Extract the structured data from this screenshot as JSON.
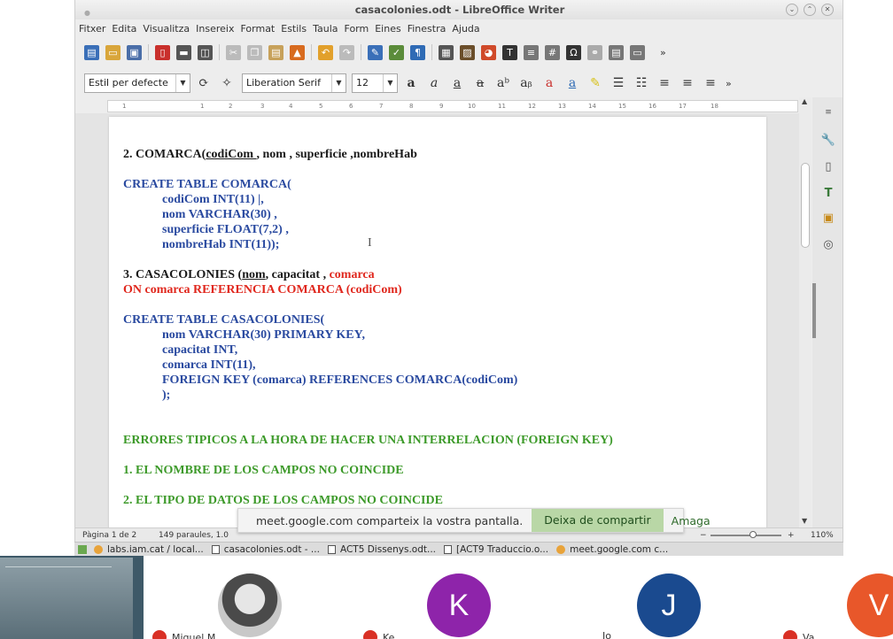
{
  "window": {
    "title": "casacolonies.odt - LibreOffice Writer"
  },
  "menu": [
    "Fitxer",
    "Edita",
    "Visualitza",
    "Insereix",
    "Format",
    "Estils",
    "Taula",
    "Form",
    "Eines",
    "Finestra",
    "Ajuda"
  ],
  "format_toolbar": {
    "paragraph_style": "Estil per defecte",
    "font_name": "Liberation Serif",
    "font_size": "12"
  },
  "ruler_ticks": [
    "1",
    "1",
    "2",
    "3",
    "4",
    "5",
    "6",
    "7",
    "8",
    "9",
    "10",
    "11",
    "12",
    "13",
    "14",
    "15",
    "16",
    "17",
    "18"
  ],
  "document": {
    "h_comarca": "2. COMARCA(",
    "h_comarca_key": "codiCom ",
    "h_comarca_rest": ", nom , superficie ,nombreHab",
    "create_comarca": "CREATE TABLE COMARCA(",
    "comarca_fields": [
      "codiCom INT(11) |,",
      "nom VARCHAR(30) ,",
      "superficie FLOAT(7,2) ,",
      "nombreHab INT(11));"
    ],
    "h_casa": "3. CASACOLONIES (",
    "h_casa_key": "nom",
    "h_casa_rest": ", capacitat , ",
    "h_casa_fk": "comarca",
    "fk_note": "ON comarca REFERENCIA COMARCA (codiCom)",
    "create_casa": "CREATE TABLE CASACOLONIES(",
    "casa_fields": [
      "nom VARCHAR(30) PRIMARY KEY,",
      "capacitat INT,",
      "comarca INT(11),",
      "FOREIGN KEY (comarca) REFERENCES COMARCA(codiCom)",
      ");"
    ],
    "errors_title": "ERRORES TIPICOS A LA HORA DE HACER UNA INTERRELACION (FOREIGN KEY)",
    "error_1": "1. EL NOMBRE DE LOS CAMPOS NO COINCIDE",
    "error_2": "2. EL TIPO DE DATOS DE LOS CAMPOS NO COINCIDE"
  },
  "statusbar": {
    "page": "Pàgina 1 de 2",
    "words": "149 paraules, 1.0",
    "zoom": "110%"
  },
  "share_bar": {
    "message": "meet.google.com comparteix la vostra pantalla.",
    "stop_label": "Deixa de compartir",
    "hide_label": "Amaga"
  },
  "taskbar": [
    "labs.iam.cat / local...",
    "casacolonies.odt - ...",
    "ACT5 Dissenys.odt...",
    "[ACT9 Traduccio.o...",
    "meet.google.com c..."
  ],
  "participants": [
    {
      "initial": "",
      "name": "Miquel M",
      "color": "#888888"
    },
    {
      "initial": "K",
      "name": "Ke",
      "color": "#8e24aa"
    },
    {
      "initial": "J",
      "name": "Jo",
      "color": "#1a4a8f"
    },
    {
      "initial": "V",
      "name": "Va",
      "color": "#e8572a"
    }
  ],
  "colors": {
    "doc_blue": "#2a4aa0",
    "doc_red": "#e0281e",
    "doc_green": "#3d9a2a",
    "share_button": "#b9d7a6"
  }
}
